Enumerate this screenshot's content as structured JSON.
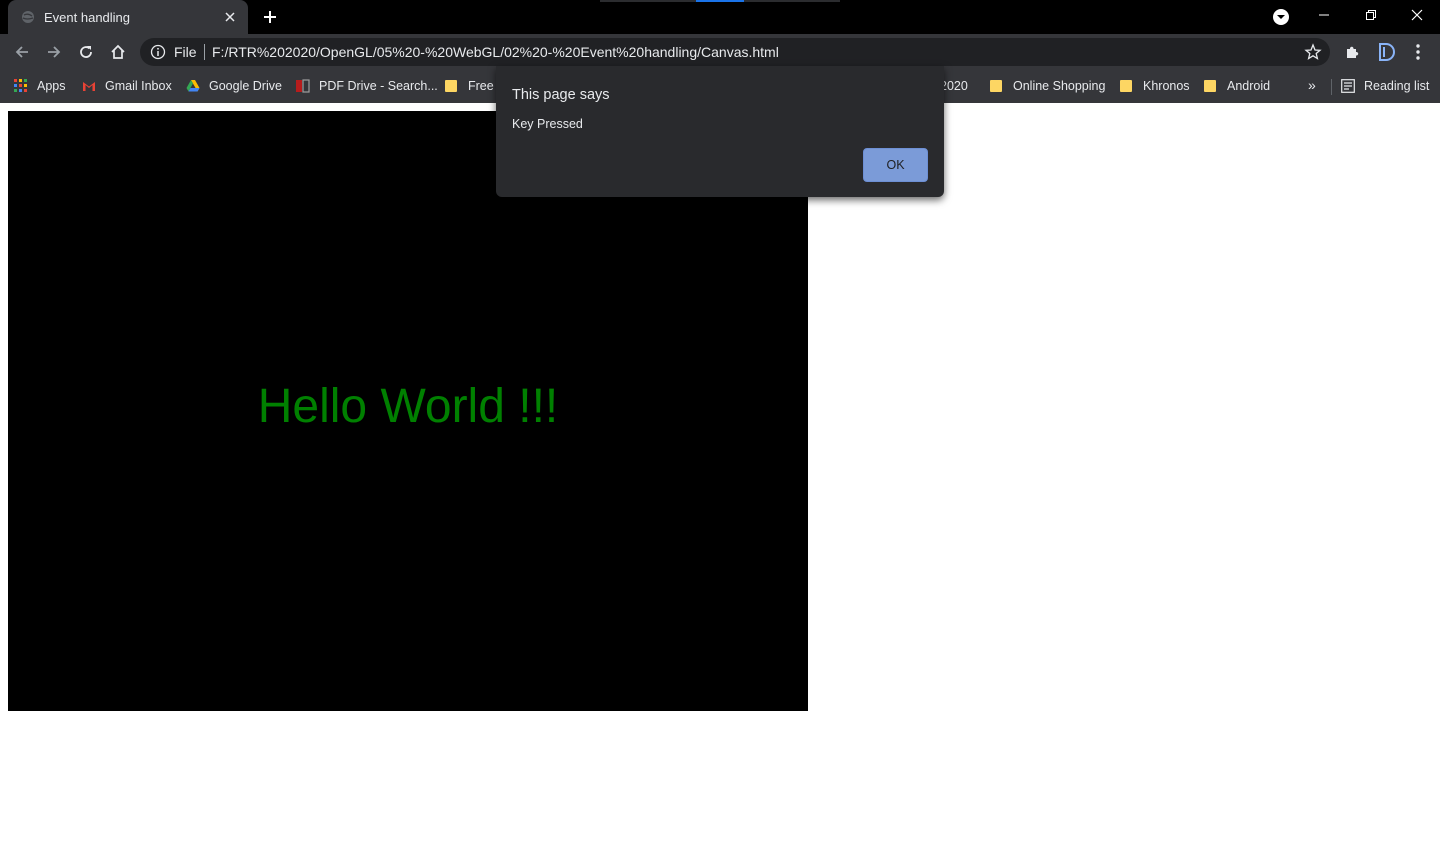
{
  "tab": {
    "title": "Event handling"
  },
  "omnibox": {
    "scheme_label": "File",
    "url": "F:/RTR%202020/OpenGL/05%20-%20WebGL/02%20-%20Event%20handling/Canvas.html"
  },
  "bookmarks": {
    "items": [
      {
        "label": "Apps",
        "icon": "apps-grid-icon"
      },
      {
        "label": "Gmail Inbox",
        "icon": "gmail-icon"
      },
      {
        "label": "Google Drive",
        "icon": "google-drive-icon"
      },
      {
        "label": "PDF Drive - Search...",
        "icon": "pdf-drive-icon"
      },
      {
        "label": "Free I",
        "icon": "folder-icon"
      },
      {
        "label": "2020",
        "icon": "folder-icon"
      },
      {
        "label": "Online Shopping",
        "icon": "folder-icon"
      },
      {
        "label": "Khronos",
        "icon": "folder-icon"
      },
      {
        "label": "Android",
        "icon": "folder-icon"
      }
    ],
    "more": "»",
    "reading_list": "Reading list"
  },
  "canvas": {
    "text": "Hello World !!!",
    "text_color": "#008000",
    "background": "#000000"
  },
  "dialog": {
    "title": "This page says",
    "message": "Key Pressed",
    "ok_label": "OK"
  },
  "colors": {
    "accent": "#1a73e8",
    "ok_button": "#7b9bd8",
    "chrome_dark": "#35363a"
  }
}
